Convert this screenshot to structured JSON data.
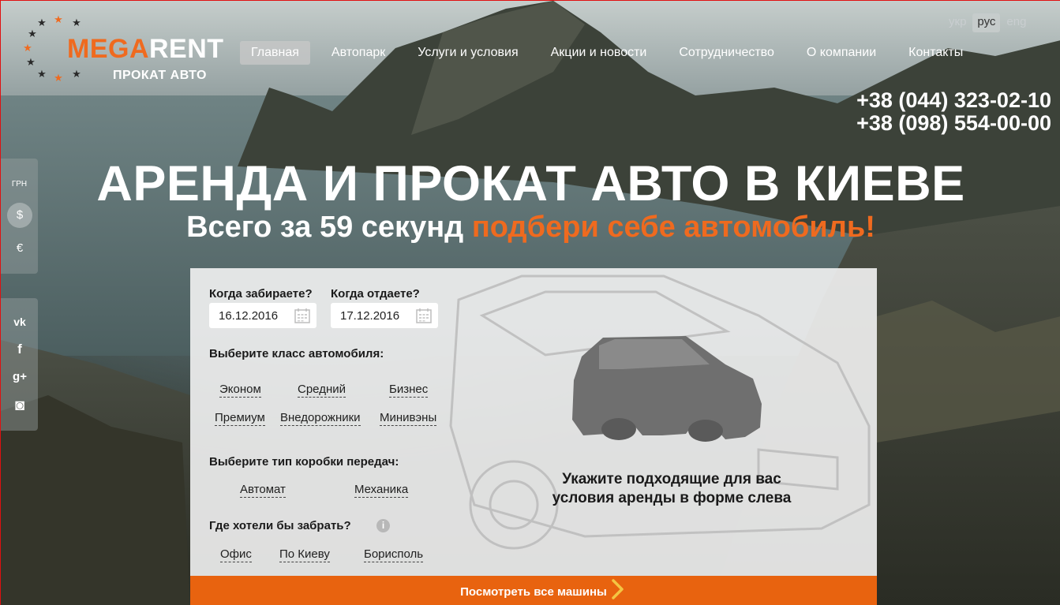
{
  "brand": {
    "name_part1": "MEGA",
    "name_part2": "RENT",
    "tagline": "ПРОКАТ АВТО",
    "accent_color": "#ef6a1f"
  },
  "nav": {
    "items": [
      {
        "label": "Главная",
        "active": true
      },
      {
        "label": "Автопарк",
        "active": false
      },
      {
        "label": "Услуги и условия",
        "active": false
      },
      {
        "label": "Акции и новости",
        "active": false
      },
      {
        "label": "Сотрудничество",
        "active": false
      },
      {
        "label": "О компании",
        "active": false
      },
      {
        "label": "Контакты",
        "active": false
      }
    ]
  },
  "languages": [
    {
      "label": "укр",
      "active": false
    },
    {
      "label": "рус",
      "active": true
    },
    {
      "label": "eng",
      "active": false
    }
  ],
  "phones": [
    "+38 (044) 323-02-10",
    "+38 (098) 554-00-00"
  ],
  "hero": {
    "title": "АРЕНДА И ПРОКАТ АВТО В КИЕВЕ",
    "subtitle_white": "Всего за 59 секунд ",
    "subtitle_orange": "подбери себе автомобиль!"
  },
  "currency": {
    "label": "ГРН",
    "options": [
      "$",
      "€"
    ]
  },
  "social": [
    "vk-icon",
    "facebook-icon",
    "google-plus-icon",
    "instagram-icon"
  ],
  "social_glyphs": [
    "vk",
    "f",
    "g+",
    "◙"
  ],
  "form": {
    "pickup_label": "Когда забираете?",
    "pickup_date": "16.12.2016",
    "return_label": "Когда отдаете?",
    "return_date": "17.12.2016",
    "class_label": "Выберите класс автомобиля:",
    "classes": [
      "Эконом",
      "Средний",
      "Бизнес",
      "Премиум",
      "Внедорожники",
      "Минивэны"
    ],
    "gearbox_label": "Выберите тип коробки передач:",
    "gearboxes": [
      "Автомат",
      "Механика"
    ],
    "location_label": "Где хотели бы забрать?",
    "locations": [
      "Офис",
      "По Киеву",
      "Борисполь"
    ],
    "hint_line1": "Укажите подходящие для вас",
    "hint_line2": "условия аренды в форме слева",
    "cta_label": "Посмотреть все машины",
    "cta_color": "#e8630f"
  }
}
